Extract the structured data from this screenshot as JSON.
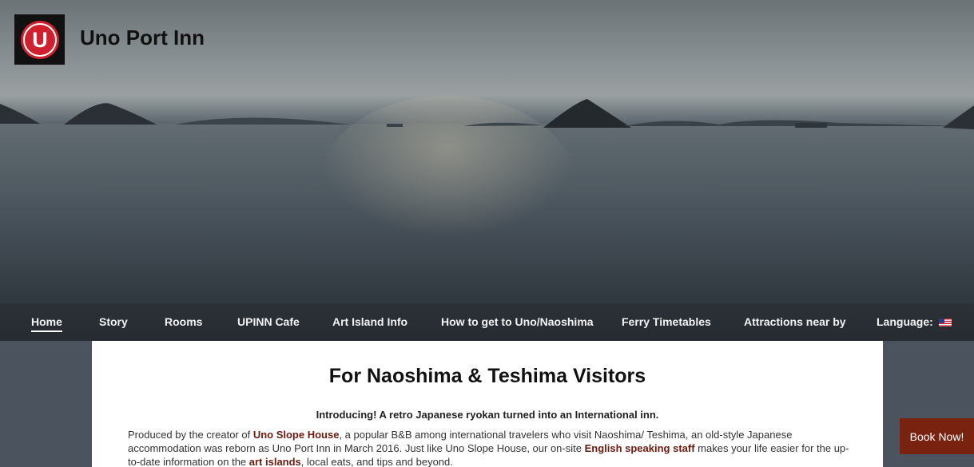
{
  "site": {
    "title": "Uno Port Inn",
    "logo_letter": "U"
  },
  "nav": {
    "items": [
      {
        "label": "Home",
        "active": true
      },
      {
        "label": "Story"
      },
      {
        "label": "Rooms"
      },
      {
        "label": "UPINN Cafe"
      },
      {
        "label": "Art Island Info"
      },
      {
        "label": "How to get to Uno/Naoshima"
      },
      {
        "label": "Ferry Timetables"
      },
      {
        "label": "Attractions near by"
      },
      {
        "label": "Language:"
      }
    ],
    "language_flag_icon": "us-flag-icon"
  },
  "main": {
    "heading": "For Naoshima & Teshima Visitors",
    "intro": "Introducing! A retro Japanese ryokan turned into an International inn.",
    "p1_a": "Produced by the creator of ",
    "p1_link1": "Uno Slope House",
    "p1_b": ", a popular B&B among international travelers who visit Naoshima/ Teshima, an old-style Japanese accommodation was reborn as Uno Port Inn in March 2016. Just like Uno Slope House, our on-site ",
    "p1_link2": "English speaking staff",
    "p1_c": " makes your life easier for the up-to-date information on the ",
    "p1_link3": "art islands",
    "p1_d": ", local eats, and tips and beyond."
  },
  "book_button": {
    "label": "Book Now!"
  },
  "colors": {
    "accent": "#7a2210",
    "link": "#6b1a0e",
    "logo_red": "#d0202e"
  }
}
